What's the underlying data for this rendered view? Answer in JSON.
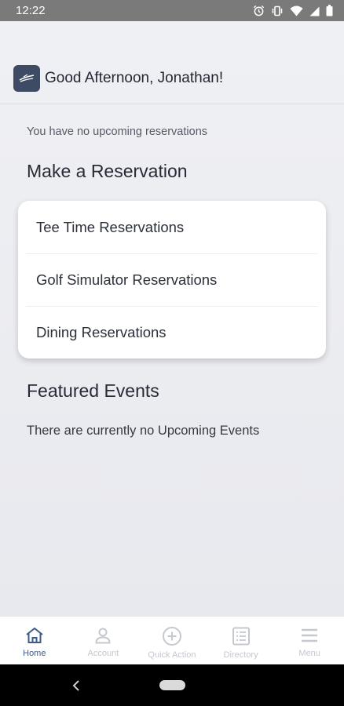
{
  "status_bar": {
    "time": "12:22",
    "icons": [
      "alarm-icon",
      "vibrate-icon",
      "wifi-icon",
      "signal-icon",
      "battery-icon"
    ]
  },
  "header": {
    "logo_icon": "club-logo-icon",
    "greeting": "Good Afternoon, Jonathan!"
  },
  "reservations": {
    "empty_text": "You have no upcoming reservations",
    "section_title": "Make a Reservation",
    "items": [
      {
        "label": "Tee Time Reservations"
      },
      {
        "label": "Golf Simulator Reservations"
      },
      {
        "label": "Dining Reservations"
      }
    ]
  },
  "events": {
    "section_title": "Featured Events",
    "empty_text": "There are currently no Upcoming Events"
  },
  "bottom_nav": {
    "items": [
      {
        "label": "Home",
        "icon": "home-icon",
        "active": true
      },
      {
        "label": "Account",
        "icon": "person-icon",
        "active": false
      },
      {
        "label": "Quick Action",
        "icon": "plus-circle-icon",
        "active": false
      },
      {
        "label": "Directory",
        "icon": "list-icon",
        "active": false
      },
      {
        "label": "Menu",
        "icon": "hamburger-icon",
        "active": false
      }
    ]
  },
  "colors": {
    "accent": "#3d5a8a",
    "inactive_nav": "#c5c8cf",
    "background": "#e9ebf0",
    "logo_bg": "#3e4b64"
  }
}
